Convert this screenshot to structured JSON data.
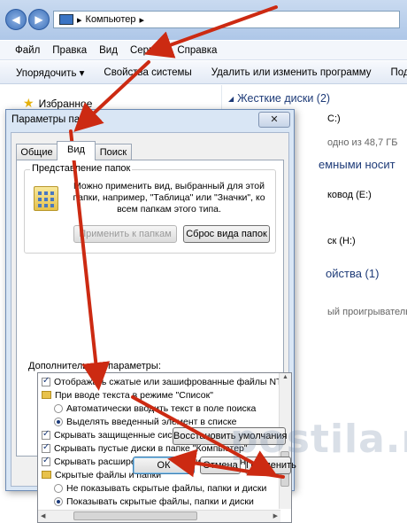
{
  "explorer": {
    "address_path": "Компьютер",
    "menu": [
      "Файл",
      "Правка",
      "Вид",
      "Сервис",
      "Справка"
    ],
    "toolbar": [
      "Упорядочить ▾",
      "Свойства системы",
      "Удалить или изменить программу",
      "Подк"
    ],
    "nav_favorites": "Избранное",
    "hard_drives_section": "Жесткие диски (2)",
    "right_texts": [
      "C:)",
      "одно из 48,7 ГБ",
      "емными носит",
      "ковод (E:)",
      "ск (H:)",
      "ойства (1)",
      "ый проигрыватель"
    ]
  },
  "dialog": {
    "title": "Параметры папок",
    "close_label": "✕",
    "tabs": [
      "Общие",
      "Вид",
      "Поиск"
    ],
    "active_tab": "Вид",
    "group_title": "Представление папок",
    "group_desc": "Можно применить вид, выбранный для этой папки, например, \"Таблица\" или \"Значки\", ко всем папкам этого типа.",
    "apply_button": "Применить к папкам",
    "reset_button": "Сброс вида папок",
    "advanced_label": "Дополнительные параметры:",
    "advanced_items": [
      {
        "type": "checkbox",
        "checked": true,
        "label": "Отображать сжатые или зашифрованные файлы NTI"
      },
      {
        "type": "folder",
        "label": "При вводе текста в режиме \"Список\""
      },
      {
        "type": "radio",
        "selected": false,
        "label": "Автоматически вводить текст в поле поиска"
      },
      {
        "type": "radio",
        "selected": true,
        "label": "Выделять введенный элемент в списке"
      },
      {
        "type": "checkbox",
        "checked": true,
        "label": "Скрывать защищенные системные файлы (рекомен"
      },
      {
        "type": "checkbox",
        "checked": true,
        "label": "Скрывать пустые диски в папке \"Компьютер\""
      },
      {
        "type": "checkbox",
        "checked": true,
        "label": "Скрывать расширения для зарегистрированных типо"
      },
      {
        "type": "folder",
        "label": "Скрытые файлы и папки"
      },
      {
        "type": "radio",
        "selected": false,
        "label": "Не показывать скрытые файлы, папки и диски"
      },
      {
        "type": "radio",
        "selected": true,
        "label": "Показывать скрытые файлы, папки и диски"
      }
    ],
    "restore_button": "Восстановить умолчания",
    "ok_button": "ОК",
    "cancel_button": "Отмена",
    "apply_bottom_button": "Применить"
  },
  "watermark": "postila.ru",
  "colors": {
    "arrow": "#cc2a12",
    "accent": "#1e3b78"
  }
}
